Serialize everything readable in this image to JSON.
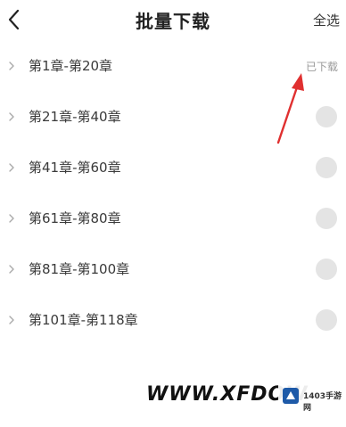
{
  "header": {
    "title": "批量下载",
    "select_all_label": "全选"
  },
  "chapters": [
    {
      "label": "第1章-第20章",
      "status": "已下载"
    },
    {
      "label": "第21章-第40章"
    },
    {
      "label": "第41章-第60章"
    },
    {
      "label": "第61章-第80章"
    },
    {
      "label": "第81章-第100章"
    },
    {
      "label": "第101章-第118章"
    }
  ],
  "watermark": {
    "text": "WWW.XFDOW",
    "brand": "1403手游网"
  },
  "colors": {
    "annotation_arrow": "#e03030",
    "checkbox": "#e4e4e4",
    "status_text": "#9a9a9a"
  }
}
